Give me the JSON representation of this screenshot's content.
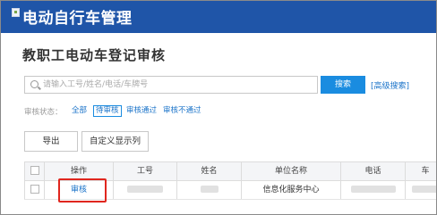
{
  "header": {
    "app_title": "电动自行车管理",
    "bg_color": "#1f55a8"
  },
  "page": {
    "title": "教职工电动车登记审核"
  },
  "search": {
    "placeholder": "请输入工号/姓名/电话/车牌号",
    "button_label": "搜索",
    "advanced_label": "[高级搜索]"
  },
  "filter": {
    "label": "审核状态：",
    "options": [
      {
        "label": "全部",
        "active": false
      },
      {
        "label": "待审核",
        "active": true
      },
      {
        "label": "审核通过",
        "active": false
      },
      {
        "label": "审核不通过",
        "active": false
      }
    ]
  },
  "toolbar": {
    "export_label": "导出",
    "columns_label": "自定义显示列"
  },
  "table": {
    "headers": [
      "操作",
      "工号",
      "姓名",
      "单位名称",
      "电话",
      "车"
    ],
    "rows": [
      {
        "action": "审核",
        "unit": "信息化服务中心"
      }
    ]
  },
  "colors": {
    "accent": "#1a8ce0",
    "link": "#1a73c9",
    "highlight": "#e0261e"
  }
}
